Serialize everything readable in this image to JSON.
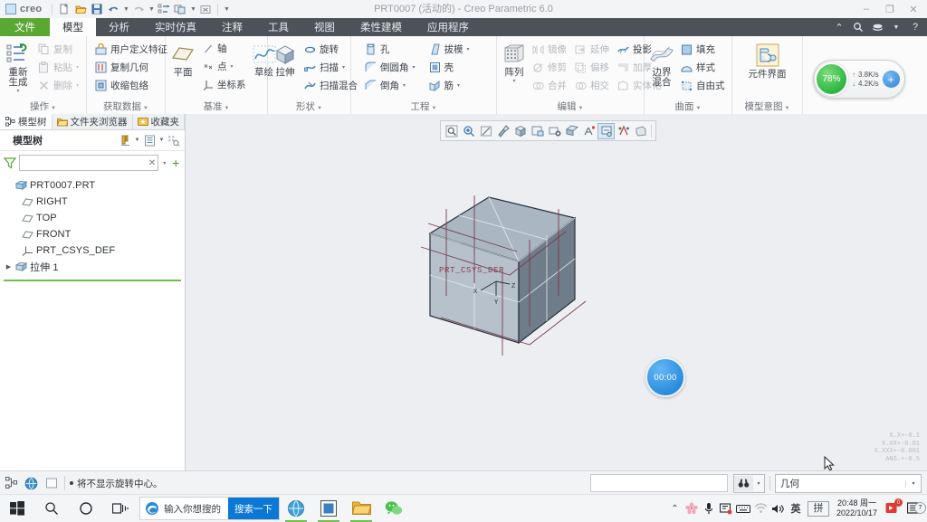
{
  "window": {
    "title": "PRT0007 (活动的) - Creo Parametric 6.0",
    "brand": "creo",
    "minimize": "–",
    "maximize": "❐",
    "close": "✕"
  },
  "quick_access": [
    {
      "name": "new-file",
      "glyph": "📄"
    },
    {
      "name": "open-file",
      "glyph": "📂"
    },
    {
      "name": "save-file",
      "glyph": "💾"
    },
    {
      "name": "undo",
      "glyph": "↰"
    },
    {
      "name": "redo",
      "glyph": "↱"
    },
    {
      "name": "regenerate-qat",
      "glyph": "⇄"
    },
    {
      "name": "window-switch",
      "glyph": "⧉"
    },
    {
      "name": "close-window",
      "glyph": "⌧"
    },
    {
      "name": "customize-qat",
      "glyph": "▾"
    }
  ],
  "ribbon_tabs": [
    {
      "label": "文件",
      "kind": "file"
    },
    {
      "label": "模型",
      "kind": "active"
    },
    {
      "label": "分析",
      "kind": "normal"
    },
    {
      "label": "实时仿真",
      "kind": "normal"
    },
    {
      "label": "注释",
      "kind": "normal"
    },
    {
      "label": "工具",
      "kind": "normal"
    },
    {
      "label": "视图",
      "kind": "normal"
    },
    {
      "label": "柔性建模",
      "kind": "normal"
    },
    {
      "label": "应用程序",
      "kind": "normal"
    }
  ],
  "ribbon_right_icons": [
    "collapse-ribbon-icon",
    "search-icon",
    "account-icon",
    "account-caret-icon",
    "help-icon"
  ],
  "ribbon_groups": [
    {
      "title": "操作",
      "big": {
        "label": "重新生成",
        "icon": "regenerate-icon",
        "caret": "▾"
      },
      "small": [
        {
          "label": "复制",
          "icon": "copy-icon",
          "disabled": true,
          "caret": ""
        },
        {
          "label": "粘贴",
          "icon": "paste-icon",
          "disabled": true,
          "caret": "▾"
        },
        {
          "label": "删除",
          "icon": "delete-icon",
          "disabled": true,
          "caret": "▾"
        }
      ]
    },
    {
      "title": "获取数据",
      "big": null,
      "small": [
        {
          "label": "用户定义特征",
          "icon": "udf-icon",
          "disabled": false,
          "caret": ""
        },
        {
          "label": "复制几何",
          "icon": "copy-geometry-icon",
          "disabled": false,
          "caret": ""
        },
        {
          "label": "收缩包络",
          "icon": "shrinkwrap-icon",
          "disabled": false,
          "caret": ""
        }
      ]
    },
    {
      "title": "基准",
      "big": {
        "label": "平面",
        "icon": "datum-plane-icon",
        "caret": ""
      },
      "small": [
        {
          "label": "轴",
          "icon": "datum-axis-icon",
          "disabled": false,
          "caret": ""
        },
        {
          "label": "点",
          "icon": "datum-point-icon",
          "disabled": false,
          "caret": "▾"
        },
        {
          "label": "坐标系",
          "icon": "datum-csys-icon",
          "disabled": false,
          "caret": ""
        }
      ],
      "big2": {
        "label": "草绘",
        "icon": "sketch-icon",
        "caret": ""
      }
    },
    {
      "title": "形状",
      "big": {
        "label": "拉伸",
        "icon": "extrude-icon",
        "caret": ""
      },
      "small": [
        {
          "label": "旋转",
          "icon": "revolve-icon",
          "disabled": false,
          "caret": ""
        },
        {
          "label": "扫描",
          "icon": "sweep-icon",
          "disabled": false,
          "caret": "▾"
        },
        {
          "label": "扫描混合",
          "icon": "swept-blend-icon",
          "disabled": false,
          "caret": ""
        }
      ]
    },
    {
      "title": "工程",
      "big": null,
      "small": [
        {
          "label": "孔",
          "icon": "hole-icon",
          "disabled": false,
          "caret": ""
        },
        {
          "label": "倒圆角",
          "icon": "round-icon",
          "disabled": false,
          "caret": "▾"
        },
        {
          "label": "倒角",
          "icon": "chamfer-icon",
          "disabled": false,
          "caret": "▾"
        }
      ],
      "small2": [
        {
          "label": "拔模",
          "icon": "draft-icon",
          "disabled": false,
          "caret": "▾"
        },
        {
          "label": "壳",
          "icon": "shell-icon",
          "disabled": false,
          "caret": ""
        },
        {
          "label": "筋",
          "icon": "rib-icon",
          "disabled": false,
          "caret": "▾"
        }
      ]
    },
    {
      "title": "编辑",
      "big": {
        "label": "阵列",
        "icon": "pattern-icon",
        "caret": "▾"
      },
      "small": [
        {
          "label": "镜像",
          "icon": "mirror-icon",
          "disabled": true,
          "caret": ""
        },
        {
          "label": "修剪",
          "icon": "trim-icon",
          "disabled": true,
          "caret": ""
        },
        {
          "label": "合并",
          "icon": "merge-icon",
          "disabled": true,
          "caret": ""
        }
      ],
      "small2": [
        {
          "label": "延伸",
          "icon": "extend-icon",
          "disabled": true,
          "caret": ""
        },
        {
          "label": "偏移",
          "icon": "offset-icon",
          "disabled": true,
          "caret": ""
        },
        {
          "label": "相交",
          "icon": "intersect-icon",
          "disabled": true,
          "caret": ""
        }
      ],
      "small3": [
        {
          "label": "投影",
          "icon": "project-icon",
          "disabled": false,
          "caret": ""
        },
        {
          "label": "加厚",
          "icon": "thicken-icon",
          "disabled": true,
          "caret": ""
        },
        {
          "label": "实体化",
          "icon": "solidify-icon",
          "disabled": true,
          "caret": ""
        }
      ]
    },
    {
      "title": "曲面",
      "big": {
        "label": "边界混合",
        "icon": "boundary-blend-icon",
        "caret": ""
      },
      "small": [
        {
          "label": "填充",
          "icon": "fill-icon",
          "disabled": false,
          "caret": ""
        },
        {
          "label": "样式",
          "icon": "style-icon",
          "disabled": false,
          "caret": ""
        },
        {
          "label": "自由式",
          "icon": "freestyle-icon",
          "disabled": false,
          "caret": ""
        }
      ]
    },
    {
      "title": "模型意图",
      "big": {
        "label": "元件界面",
        "icon": "component-interface-icon",
        "caret": ""
      },
      "small": []
    }
  ],
  "nav_tabs": [
    {
      "label": "模型树",
      "icon": "model-tree-icon",
      "active": true
    },
    {
      "label": "文件夹浏览器",
      "icon": "folder-browser-icon",
      "active": false
    },
    {
      "label": "收藏夹",
      "icon": "favorites-icon",
      "active": false
    }
  ],
  "tree_header": {
    "title": "模型树",
    "tools": [
      "tree-filters-icon",
      "tree-filters-caret",
      "tree-columns-icon",
      "tree-columns-caret",
      "tree-display-icon"
    ]
  },
  "filter": {
    "value": "",
    "placeholder": "",
    "clear": "✕",
    "caret": "▾",
    "add": "+"
  },
  "model_tree": [
    {
      "label": "PRT0007.PRT",
      "icon": "part-icon",
      "indent": 0,
      "expander": ""
    },
    {
      "label": "RIGHT",
      "icon": "datum-plane-icon",
      "indent": 1,
      "expander": ""
    },
    {
      "label": "TOP",
      "icon": "datum-plane-icon",
      "indent": 1,
      "expander": ""
    },
    {
      "label": "FRONT",
      "icon": "datum-plane-icon",
      "indent": 1,
      "expander": ""
    },
    {
      "label": "PRT_CSYS_DEF",
      "icon": "csys-icon",
      "indent": 1,
      "expander": ""
    },
    {
      "label": "拉伸 1",
      "icon": "extrude-feature-icon",
      "indent": 0,
      "expander": "▶"
    }
  ],
  "graphics_toolbar": [
    {
      "name": "refit-icon"
    },
    {
      "name": "zoom-in-icon"
    },
    {
      "name": "zoom-out-icon"
    },
    {
      "name": "repaint-icon"
    },
    {
      "name": "saved-orientations-icon"
    },
    {
      "name": "view-manager-icon"
    },
    {
      "name": "named-views-icon"
    },
    {
      "name": "datum-display-icon"
    },
    {
      "name": "spin-center-icon",
      "active": true
    },
    {
      "name": "annotation-display-icon"
    },
    {
      "name": "appearance-icon"
    },
    {
      "name": "perspective-icon"
    }
  ],
  "viewport": {
    "csys_label": "PRT_CSYS_DEF",
    "axis_x": "X",
    "axis_y": "Y",
    "axis_z": "Z",
    "timer": "00:00",
    "accuracy": [
      "X.X+-0.1",
      "X.XX+-0.01",
      "X.XXX+-0.001",
      "ANG.+-0.5"
    ]
  },
  "network_widget": {
    "percent": "78%",
    "upload": "3.8K/s",
    "download": "4.2K/s",
    "up_arrow": "↑",
    "down_arrow": "↓",
    "expand": "+"
  },
  "status_bar": {
    "icons": [
      "model-tree-toggle-icon",
      "browser-toggle-icon",
      "fullscreen-toggle-icon"
    ],
    "message": "将不显示旋转中心。",
    "find_icon": "binoculars-icon",
    "find_caret": "▾",
    "selection_filter": "几何",
    "selection_caret": "▾"
  },
  "taskbar": {
    "start_icon": "windows-start-icon",
    "search_icon": "search-icon",
    "cortana_icon": "cortana-icon",
    "taskview_icon": "task-view-icon",
    "edge_placeholder": "输入你想搜的",
    "edge_button": "搜索一下",
    "apps": [
      "browser-app-icon",
      "creo-app-icon",
      "file-explorer-icon",
      "wechat-icon"
    ],
    "tray_icons": [
      "show-hidden-icon",
      "sakura-icon",
      "microphone-icon",
      "screen-icon",
      "keyboard-icon",
      "wifi-icon",
      "volume-icon"
    ],
    "ime_lang": "英",
    "ime_mode": "拼",
    "clock_time": "20:48 周一",
    "clock_date": "2022/10/17",
    "recorder_badge": "0",
    "notification_badge": "7"
  }
}
